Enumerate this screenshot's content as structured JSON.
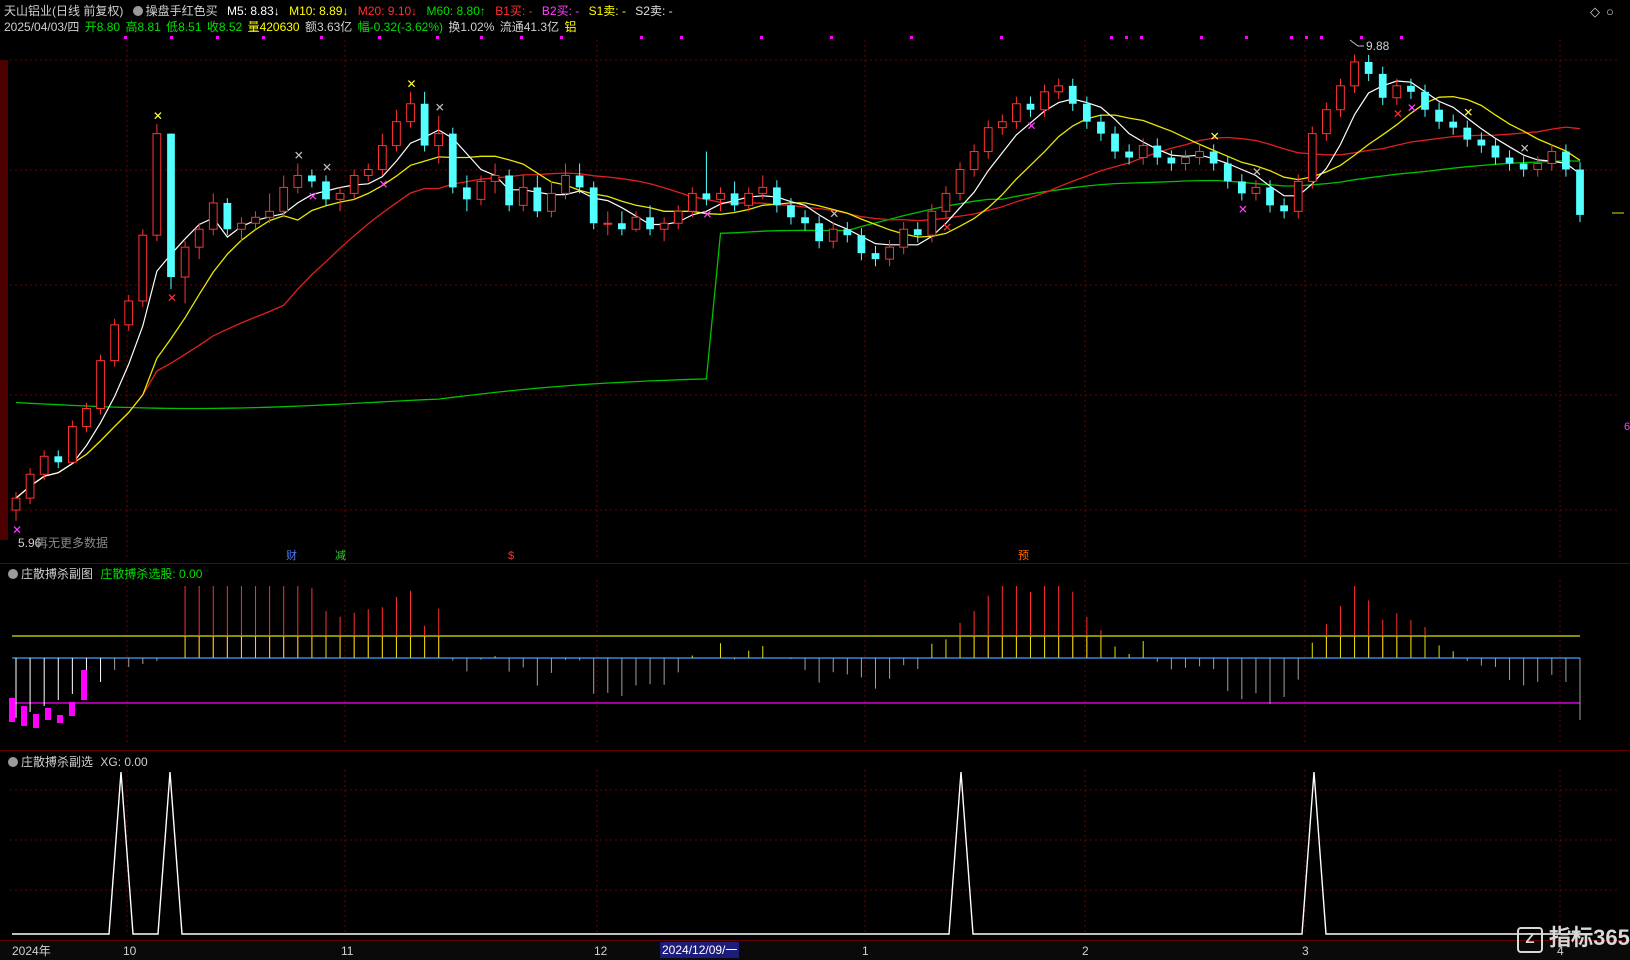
{
  "header": {
    "stock_name": "天山铝业(日线 前复权)",
    "indicator_name": "操盘手红色买",
    "ma5": "M5: 8.83↓",
    "ma10": "M10: 8.89↓",
    "ma20": "M20: 9.10↓",
    "ma60": "M60: 8.80↑",
    "b1": "B1买: -",
    "b2": "B2买: -",
    "s1": "S1卖: -",
    "s2": "S2卖: -",
    "date": "2025/04/03/四",
    "open": "开8.80",
    "high": "高8.81",
    "low": "低8.51",
    "close": "收8.52",
    "volume": "量420630",
    "amount": "额3.63亿",
    "change": "幅-0.32(-3.62%)",
    "turnover": "换1.02%",
    "float_cap": "流通41.3亿",
    "sector": "铝"
  },
  "main_chart": {
    "high_label": "9.88",
    "low_label": "5.96",
    "overlay_text": "再无更多数据",
    "event_marks": [
      {
        "label": "财",
        "color": "#4a7cff"
      },
      {
        "label": "减",
        "color": "#33cc33"
      },
      {
        "label": "$",
        "color": "#ff3333"
      },
      {
        "label": "预",
        "color": "#ff6600"
      }
    ]
  },
  "sub1": {
    "title": "庄散搏杀副图",
    "value_label": "庄散搏杀选股: 0.00"
  },
  "sub2": {
    "title": "庄散搏杀副选",
    "value_label": "XG: 0.00"
  },
  "x_axis": {
    "labels": [
      "2024年",
      "10",
      "11",
      "12",
      "2024/12/09/一",
      "1",
      "2",
      "3",
      "4"
    ]
  },
  "brand": {
    "logo_text": "指标365"
  },
  "colors": {
    "up": "#ff3232",
    "down": "#54ffff",
    "ma5": "#ffffff",
    "ma10": "#ffff00",
    "ma20": "#ff2020",
    "ma60": "#00c000",
    "magenta": "#ff00ff",
    "sep": "#6a0000"
  },
  "chart_data": [
    {
      "type": "candlestick",
      "title": "天山铝业(日线 前复权)",
      "series_names": [
        "M5",
        "M10",
        "M20",
        "M60"
      ],
      "max_price": 9.88,
      "min_price": 5.96,
      "last_close": 8.52,
      "x_axis_labels": [
        "2024年",
        "10",
        "11",
        "12",
        "1",
        "2",
        "3",
        "4"
      ],
      "candles_ohlc": [
        [
          6.05,
          6.2,
          5.96,
          6.15
        ],
        [
          6.15,
          6.4,
          6.1,
          6.35
        ],
        [
          6.35,
          6.55,
          6.3,
          6.5
        ],
        [
          6.5,
          6.55,
          6.4,
          6.45
        ],
        [
          6.45,
          6.8,
          6.45,
          6.75
        ],
        [
          6.75,
          6.95,
          6.7,
          6.9
        ],
        [
          6.9,
          7.35,
          6.85,
          7.3
        ],
        [
          7.3,
          7.65,
          7.25,
          7.6
        ],
        [
          7.6,
          7.85,
          7.55,
          7.8
        ],
        [
          7.8,
          8.4,
          7.75,
          8.35
        ],
        [
          8.35,
          9.28,
          8.3,
          9.2
        ],
        [
          9.2,
          9.2,
          7.9,
          8.0
        ],
        [
          8.0,
          8.3,
          7.78,
          8.25
        ],
        [
          8.25,
          8.45,
          8.15,
          8.4
        ],
        [
          8.4,
          8.7,
          8.35,
          8.62
        ],
        [
          8.62,
          8.66,
          8.35,
          8.4
        ],
        [
          8.4,
          8.5,
          8.3,
          8.45
        ],
        [
          8.45,
          8.55,
          8.4,
          8.5
        ],
        [
          8.5,
          8.7,
          8.45,
          8.55
        ],
        [
          8.55,
          8.85,
          8.5,
          8.75
        ],
        [
          8.75,
          8.95,
          8.7,
          8.85
        ],
        [
          8.85,
          8.9,
          8.75,
          8.8
        ],
        [
          8.8,
          8.85,
          8.6,
          8.65
        ],
        [
          8.65,
          8.75,
          8.55,
          8.7
        ],
        [
          8.7,
          8.9,
          8.65,
          8.85
        ],
        [
          8.85,
          8.95,
          8.8,
          8.9
        ],
        [
          8.9,
          9.2,
          8.85,
          9.1
        ],
        [
          9.1,
          9.4,
          9.05,
          9.3
        ],
        [
          9.3,
          9.55,
          9.25,
          9.45
        ],
        [
          9.45,
          9.55,
          9.05,
          9.1
        ],
        [
          9.1,
          9.35,
          8.95,
          9.2
        ],
        [
          9.2,
          9.25,
          8.7,
          8.75
        ],
        [
          8.75,
          8.85,
          8.55,
          8.65
        ],
        [
          8.65,
          8.85,
          8.6,
          8.8
        ],
        [
          8.8,
          8.95,
          8.7,
          8.85
        ],
        [
          8.85,
          8.9,
          8.55,
          8.6
        ],
        [
          8.6,
          8.85,
          8.55,
          8.75
        ],
        [
          8.75,
          8.85,
          8.5,
          8.55
        ],
        [
          8.55,
          8.8,
          8.5,
          8.7
        ],
        [
          8.7,
          8.95,
          8.65,
          8.85
        ],
        [
          8.85,
          8.95,
          8.7,
          8.75
        ],
        [
          8.75,
          8.8,
          8.4,
          8.45
        ],
        [
          8.45,
          8.55,
          8.35,
          8.45
        ],
        [
          8.45,
          8.55,
          8.35,
          8.4
        ],
        [
          8.4,
          8.55,
          8.38,
          8.5
        ],
        [
          8.5,
          8.6,
          8.35,
          8.4
        ],
        [
          8.4,
          8.5,
          8.3,
          8.45
        ],
        [
          8.45,
          8.6,
          8.4,
          8.55
        ],
        [
          8.55,
          8.75,
          8.5,
          8.7
        ],
        [
          8.7,
          9.05,
          8.6,
          8.65
        ],
        [
          8.65,
          8.75,
          8.55,
          8.7
        ],
        [
          8.7,
          8.8,
          8.55,
          8.6
        ],
        [
          8.6,
          8.75,
          8.55,
          8.7
        ],
        [
          8.7,
          8.85,
          8.65,
          8.75
        ]
      ],
      "sub_indicator_title": "庄散搏杀副图",
      "sub_indicator_value": 0.0,
      "xg_title": "庄散搏杀副选",
      "xg_value": 0.0,
      "xg_signal_count": 5
    }
  ]
}
